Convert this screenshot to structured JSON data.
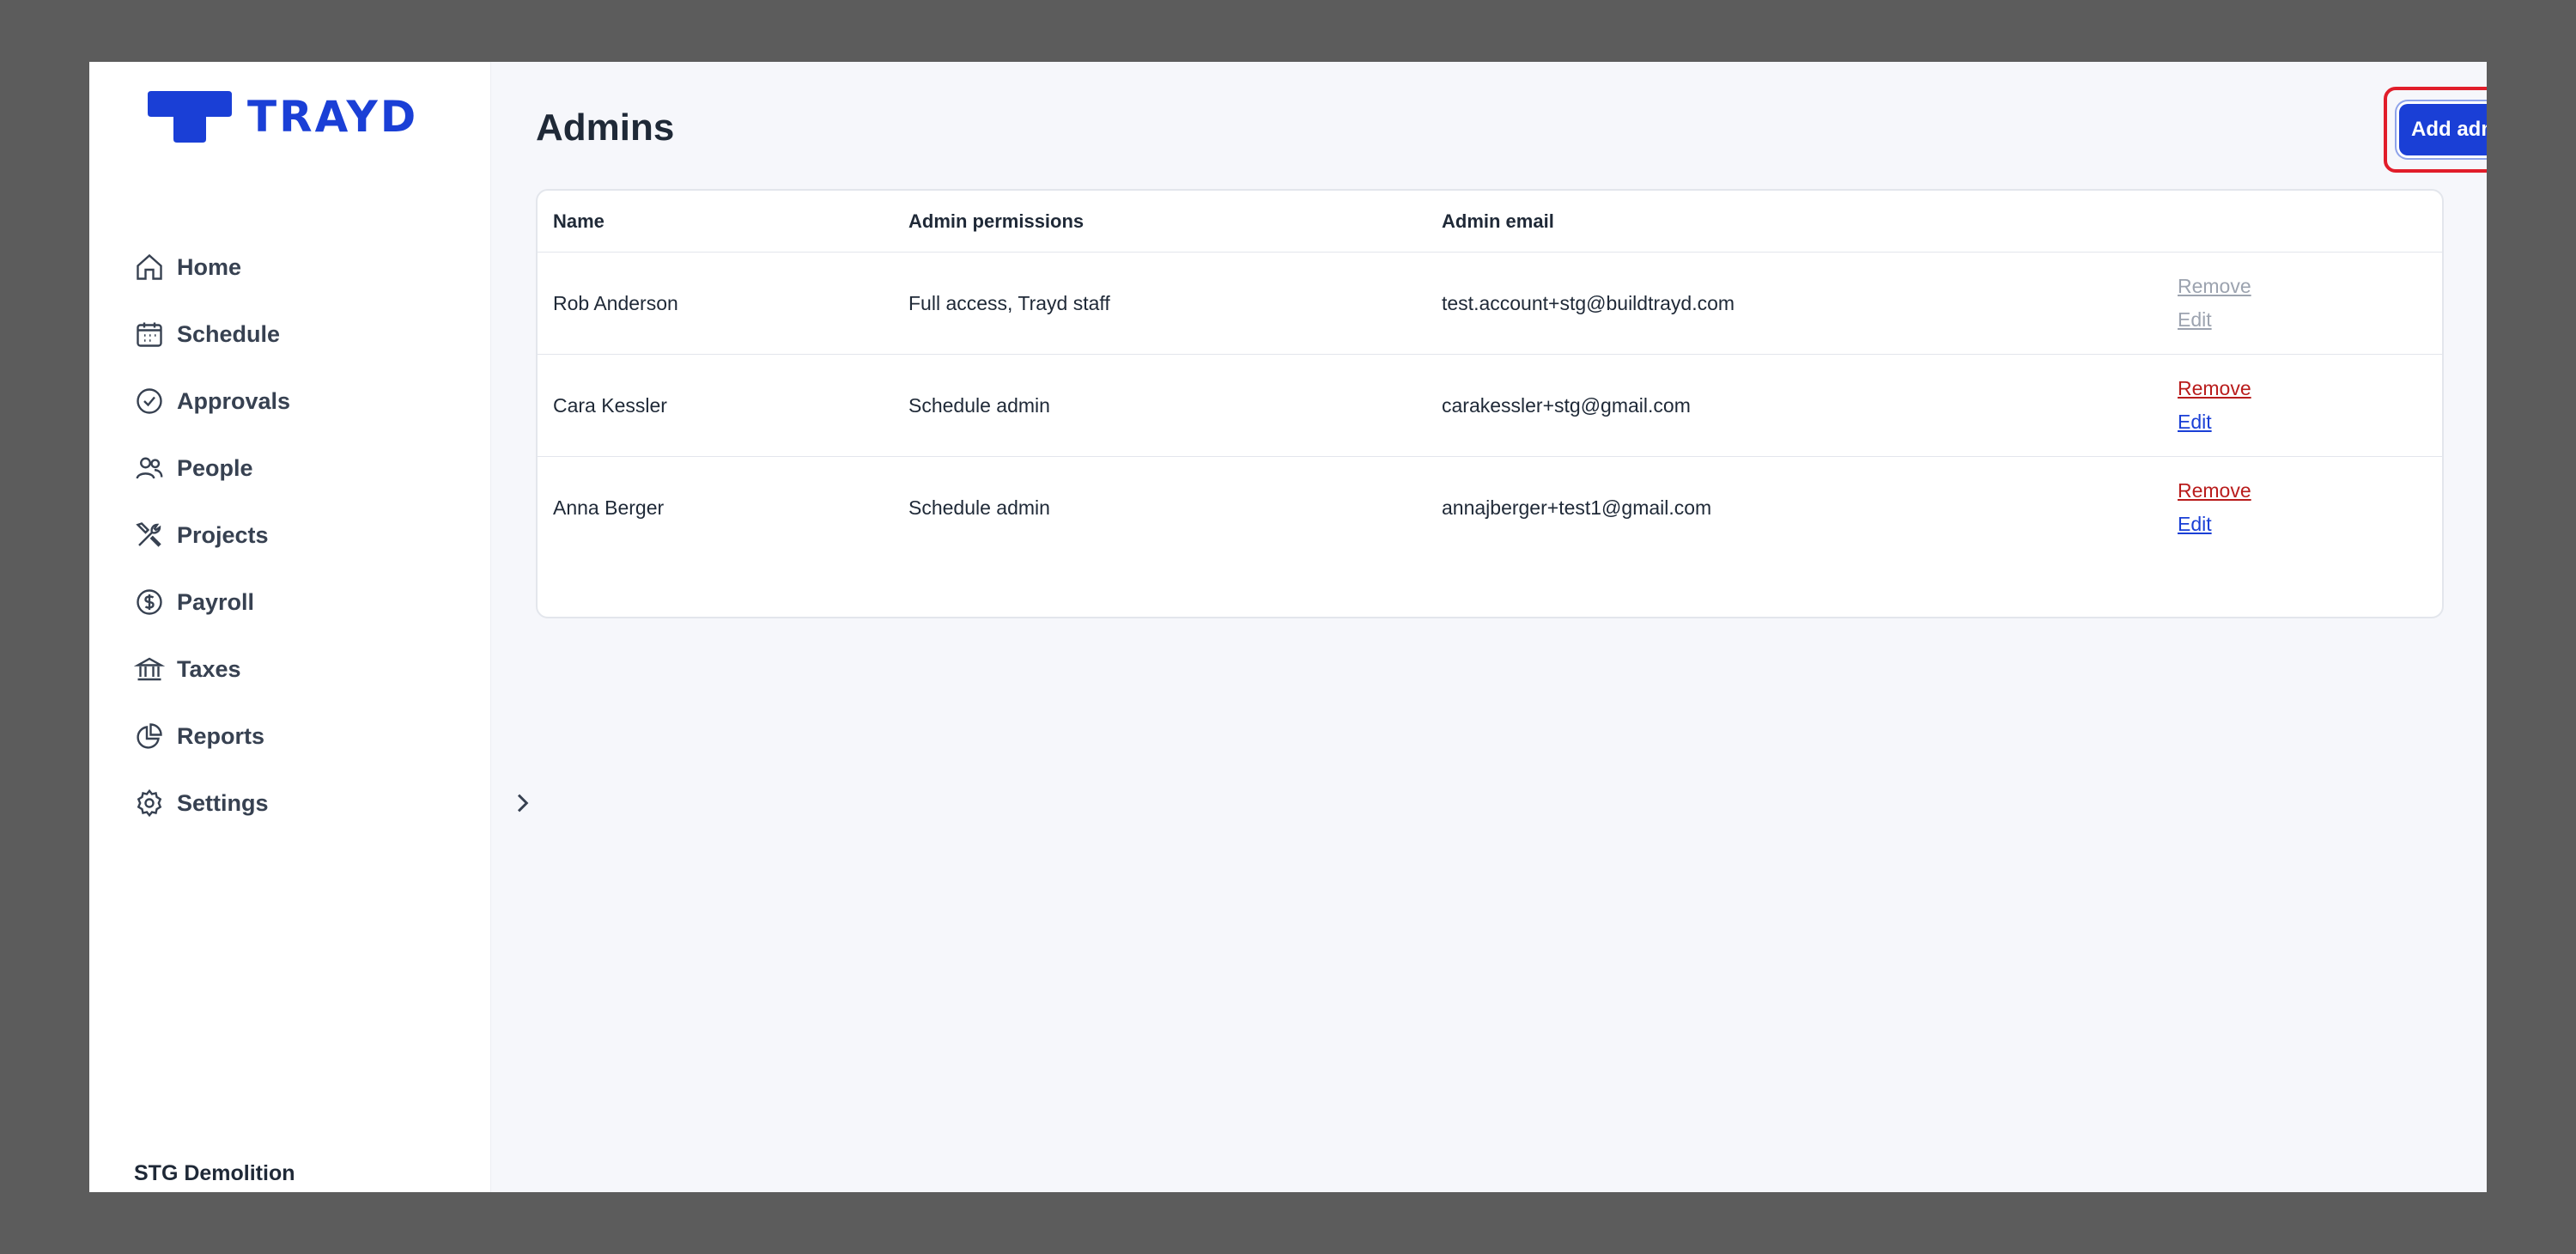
{
  "brand": {
    "logo_text": "TRAYD",
    "accent_color": "#1a3fd6"
  },
  "sidebar": {
    "items": [
      {
        "label": "Home",
        "icon": "home-icon"
      },
      {
        "label": "Schedule",
        "icon": "calendar-icon"
      },
      {
        "label": "Approvals",
        "icon": "check-circle-icon"
      },
      {
        "label": "People",
        "icon": "people-icon"
      },
      {
        "label": "Projects",
        "icon": "tools-icon"
      },
      {
        "label": "Payroll",
        "icon": "dollar-circle-icon"
      },
      {
        "label": "Taxes",
        "icon": "bank-icon"
      },
      {
        "label": "Reports",
        "icon": "pie-chart-icon"
      },
      {
        "label": "Settings",
        "icon": "gear-icon"
      }
    ],
    "company_name": "STG Demolition"
  },
  "main": {
    "title": "Admins",
    "add_button_label": "Add admin",
    "table": {
      "headers": {
        "name": "Name",
        "permissions": "Admin permissions",
        "email": "Admin email"
      },
      "rows": [
        {
          "name": "Rob Anderson",
          "permissions": "Full access, Trayd staff",
          "email": "test.account+stg@buildtrayd.com",
          "remove": "Remove",
          "edit": "Edit",
          "actions_disabled": true
        },
        {
          "name": "Cara Kessler",
          "permissions": "Schedule admin",
          "email": "carakessler+stg@gmail.com",
          "remove": "Remove",
          "edit": "Edit",
          "actions_disabled": false
        },
        {
          "name": "Anna Berger",
          "permissions": "Schedule admin",
          "email": "annajberger+test1@gmail.com",
          "remove": "Remove",
          "edit": "Edit",
          "actions_disabled": false
        }
      ]
    }
  }
}
